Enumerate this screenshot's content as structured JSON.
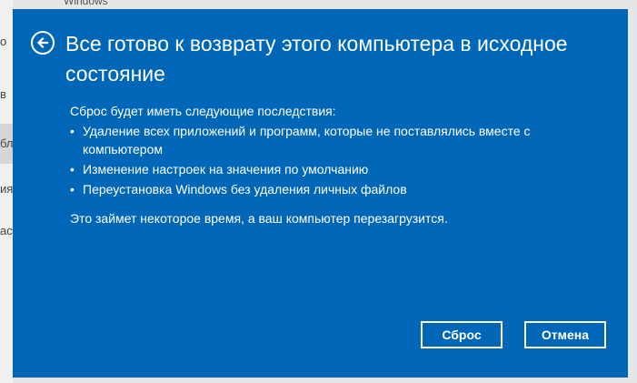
{
  "background": {
    "top_text": "Windows",
    "items": [
      "о",
      "в",
      "бл",
      "ия",
      "ас"
    ]
  },
  "dialog": {
    "title": "Все готово к возврату этого компьютера в исходное состояние",
    "intro": "Сброс будет иметь следующие последствия:",
    "effects": [
      "Удаление всех приложений и программ, которые не поставлялись вместе с компьютером",
      "Изменение настроек на значения по умолчанию",
      "Переустановка Windows без удаления личных файлов"
    ],
    "bullet": "•",
    "note": "Это займет некоторое время, а ваш компьютер перезагрузится.",
    "reset_label": "Сброс",
    "cancel_label": "Отмена",
    "back_icon": "back-arrow-icon",
    "accent_color": "#0067b8"
  }
}
